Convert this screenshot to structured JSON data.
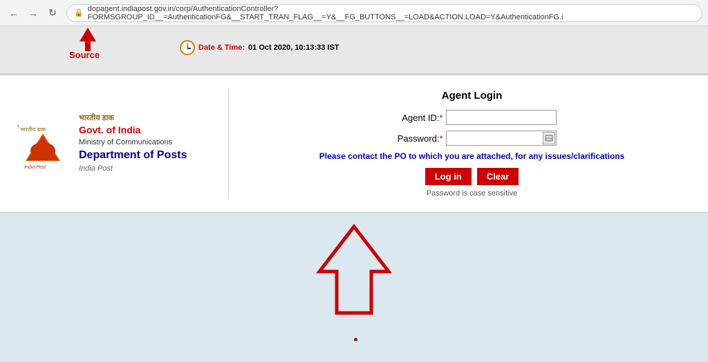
{
  "browser": {
    "url": "dopagent.indiapost.gov.in/corp/AuthenticationController?FORMSGROUP_ID__=AuthenticationFG&__START_TRAN_FLAG__=Y&__FG_BUTTONS__=LOAD&ACTION.LOAD=Y&AuthenticationFG.i",
    "back_label": "←",
    "forward_label": "→",
    "reload_label": "↻"
  },
  "annotation": {
    "source_label": "Source",
    "datetime_label": "Date & Time:",
    "datetime_value": "01 Oct 2020, 10:13:33 IST"
  },
  "header": {
    "ashoka": "भारतीय डाक",
    "govt": "Govt. of India",
    "ministry": "Ministry of Communications",
    "dept": "Department of Posts",
    "india_post": "India Post"
  },
  "login": {
    "title": "Agent Login",
    "agent_id_label": "Agent ID:",
    "password_label": "Password:",
    "required_marker": "*",
    "contact_message": "Please contact the PO to which you are attached, for any issues/clarifications",
    "login_button": "Log in",
    "clear_button": "Clear",
    "case_note": "Password is case sensitive",
    "agent_id_value": "",
    "password_value": ""
  }
}
